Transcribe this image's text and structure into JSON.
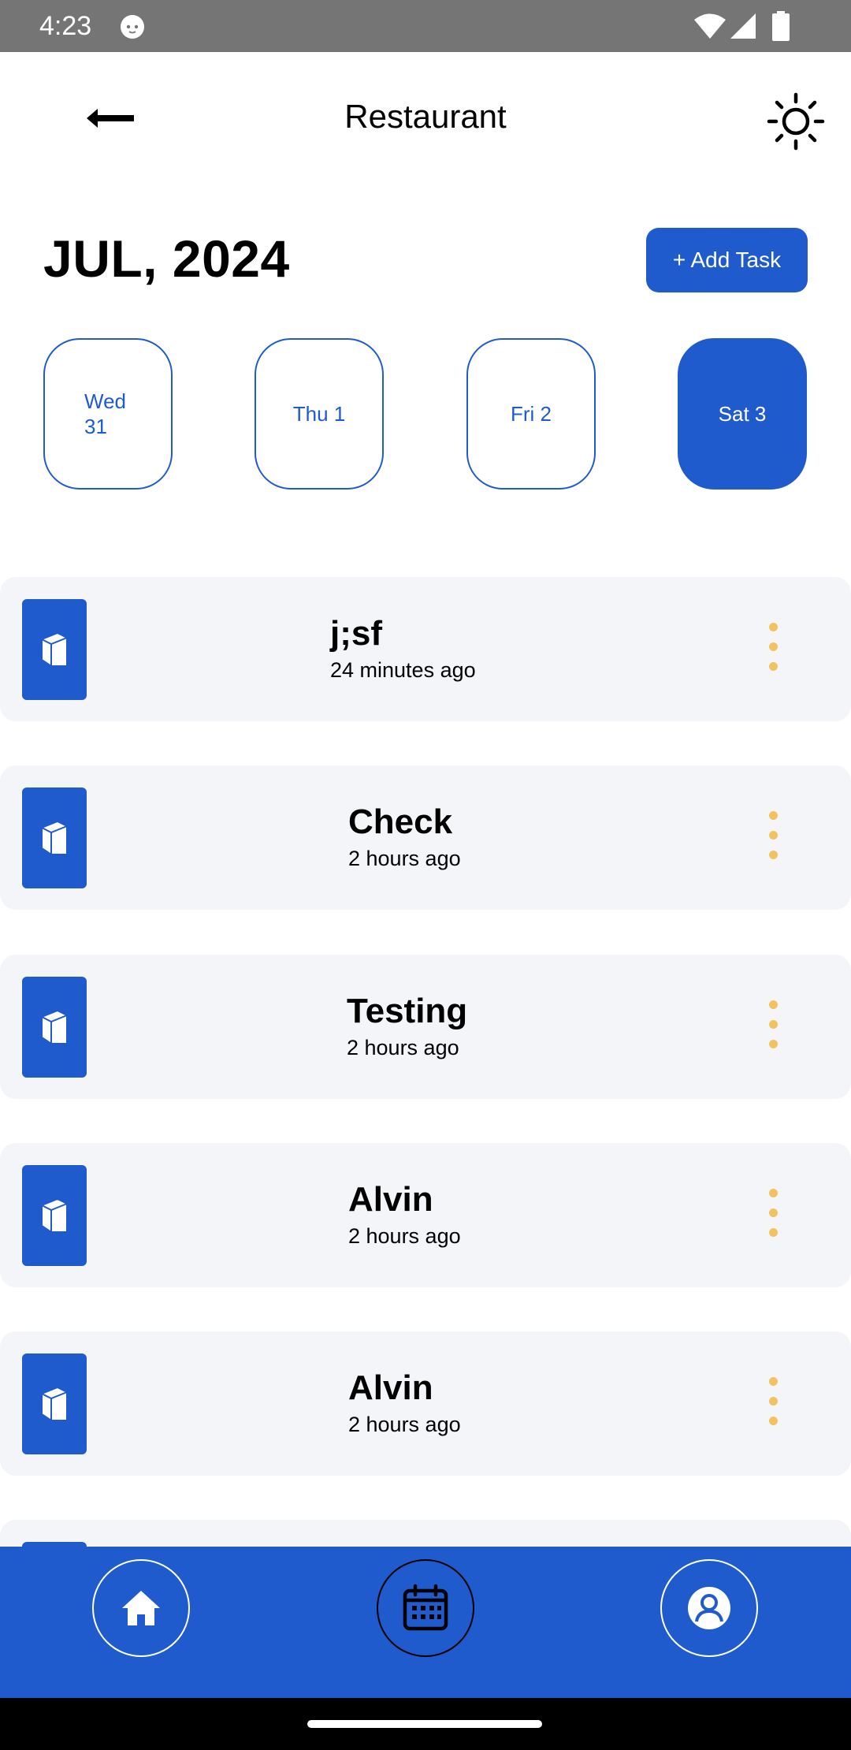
{
  "status_bar": {
    "time": "4:23"
  },
  "header": {
    "title": "Restaurant"
  },
  "calendar": {
    "month": "JUL, 2024",
    "add_task_label": "+ Add Task",
    "days": [
      {
        "label": "Wed 31",
        "selected": false
      },
      {
        "label": "Thu 1",
        "selected": false
      },
      {
        "label": "Fri 2",
        "selected": false
      },
      {
        "label": "Sat 3",
        "selected": true
      }
    ]
  },
  "tasks": [
    {
      "title": "j;sf",
      "time": "24 minutes ago"
    },
    {
      "title": "Check",
      "time": "2 hours ago"
    },
    {
      "title": "Testing",
      "time": "2 hours ago"
    },
    {
      "title": "Alvin",
      "time": "2 hours ago"
    },
    {
      "title": "Alvin",
      "time": "2 hours ago"
    }
  ],
  "icons": {
    "back": "arrow-left-icon",
    "theme": "sun-icon",
    "task": "book-icon",
    "menu": "more-vertical-icon",
    "nav": [
      "home-icon",
      "calendar-icon",
      "user-profile-icon"
    ]
  },
  "colors": {
    "primary": "#1f5bcc",
    "menu_dots": "#f2c261",
    "card_bg": "#f4f5f9"
  }
}
